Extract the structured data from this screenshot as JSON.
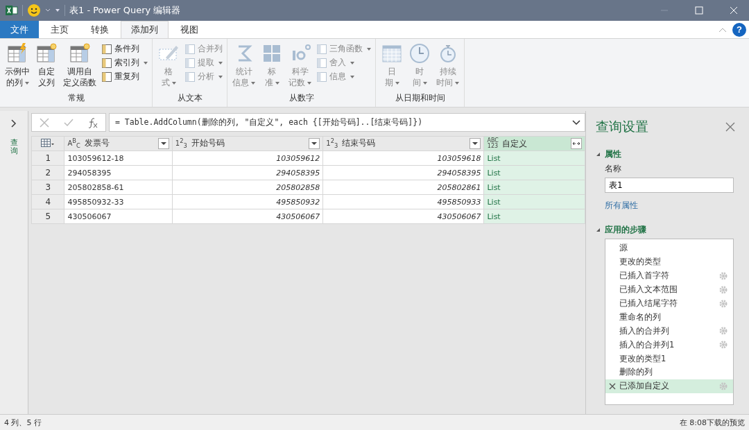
{
  "window": {
    "title": "表1 - Power Query 编辑器"
  },
  "tabs": [
    {
      "label": "文件",
      "kind": "file",
      "selected": false
    },
    {
      "label": "主页",
      "kind": "tab",
      "selected": false
    },
    {
      "label": "转换",
      "kind": "tab",
      "selected": false
    },
    {
      "label": "添加列",
      "kind": "tab",
      "selected": true
    },
    {
      "label": "视图",
      "kind": "tab",
      "selected": false
    }
  ],
  "help": "?",
  "ribbon_groups": [
    {
      "label": "常规",
      "disabled": false,
      "items": [
        {
          "kind": "large",
          "lines": [
            "示例中",
            "的列"
          ],
          "dropdown": true
        },
        {
          "kind": "large",
          "lines": [
            "自定",
            "义列"
          ],
          "dropdown": false
        },
        {
          "kind": "large",
          "lines": [
            "调用自",
            "定义函数"
          ],
          "dropdown": false
        },
        {
          "kind": "stack",
          "items": [
            {
              "label": "条件列",
              "dropdown": false
            },
            {
              "label": "索引列",
              "dropdown": true
            },
            {
              "label": "重复列",
              "dropdown": false
            }
          ]
        }
      ]
    },
    {
      "label": "从文本",
      "disabled": true,
      "items": [
        {
          "kind": "large",
          "lines": [
            "格",
            "式"
          ],
          "dropdown": true
        },
        {
          "kind": "stack",
          "items": [
            {
              "label": "合并列",
              "dropdown": false
            },
            {
              "label": "提取",
              "dropdown": true
            },
            {
              "label": "分析",
              "dropdown": true
            }
          ]
        }
      ]
    },
    {
      "label": "从数字",
      "disabled": true,
      "items": [
        {
          "kind": "large",
          "lines": [
            "统计",
            "信息"
          ],
          "dropdown": true
        },
        {
          "kind": "large",
          "lines": [
            "标",
            "准"
          ],
          "dropdown": true
        },
        {
          "kind": "large",
          "lines": [
            "科学",
            "记数"
          ],
          "dropdown": true
        },
        {
          "kind": "stack",
          "items": [
            {
              "label": "三角函数",
              "dropdown": true
            },
            {
              "label": "舍入",
              "dropdown": true
            },
            {
              "label": "信息",
              "dropdown": true
            }
          ]
        }
      ]
    },
    {
      "label": "从日期和时间",
      "disabled": true,
      "items": [
        {
          "kind": "large",
          "lines": [
            "日",
            "期"
          ],
          "dropdown": true
        },
        {
          "kind": "large",
          "lines": [
            "时",
            "间"
          ],
          "dropdown": true
        },
        {
          "kind": "large",
          "lines": [
            "持续",
            "时间"
          ],
          "dropdown": true
        }
      ]
    }
  ],
  "queries_pane": {
    "label": "查询"
  },
  "formula_bar": {
    "formula": "= Table.AddColumn(删除的列, \"自定义\", each {[开始号码]..[结束号码]})"
  },
  "table": {
    "columns": [
      {
        "name": "发票号",
        "kind": "text",
        "type_label": "A$^{B}$$_{C}$",
        "selected": false
      },
      {
        "name": "开始号码",
        "kind": "number",
        "type_label": "1$^{2}$$_{3}$",
        "selected": false
      },
      {
        "name": "结束号码",
        "kind": "number",
        "type_label": "1$^{2}$$_{3}$",
        "selected": false
      },
      {
        "name": "自定义",
        "kind": "any",
        "type_label": "ABC 123",
        "selected": true
      }
    ],
    "rows": [
      {
        "index": "1",
        "cells": [
          "103059612-18",
          "103059612",
          "103059618",
          "List"
        ]
      },
      {
        "index": "2",
        "cells": [
          "294058395",
          "294058395",
          "294058395",
          "List"
        ]
      },
      {
        "index": "3",
        "cells": [
          "205802858-61",
          "205802858",
          "205802861",
          "List"
        ]
      },
      {
        "index": "4",
        "cells": [
          "495850932-33",
          "495850932",
          "495850933",
          "List"
        ]
      },
      {
        "index": "5",
        "cells": [
          "430506067",
          "430506067",
          "430506067",
          "List"
        ]
      }
    ]
  },
  "query_settings": {
    "title": "查询设置",
    "properties": {
      "heading": "属性",
      "expanded": true,
      "name_label": "名称",
      "name_value": "表1",
      "all_properties": "所有属性"
    },
    "steps_section": {
      "heading": "应用的步骤",
      "expanded": true
    },
    "steps": [
      {
        "label": "源",
        "gear": false,
        "selected": false
      },
      {
        "label": "更改的类型",
        "gear": false,
        "selected": false
      },
      {
        "label": "已插入首字符",
        "gear": true,
        "selected": false
      },
      {
        "label": "已插入文本范围",
        "gear": true,
        "selected": false
      },
      {
        "label": "已插入结尾字符",
        "gear": true,
        "selected": false
      },
      {
        "label": "重命名的列",
        "gear": false,
        "selected": false
      },
      {
        "label": "插入的合并列",
        "gear": true,
        "selected": false
      },
      {
        "label": "插入的合并列1",
        "gear": true,
        "selected": false
      },
      {
        "label": "更改的类型1",
        "gear": false,
        "selected": false
      },
      {
        "label": "删除的列",
        "gear": false,
        "selected": false
      },
      {
        "label": "已添加自定义",
        "gear": true,
        "selected": true
      }
    ]
  },
  "status_bar": {
    "left": "4 列、5 行",
    "right": "在 8:08下载的预览"
  }
}
